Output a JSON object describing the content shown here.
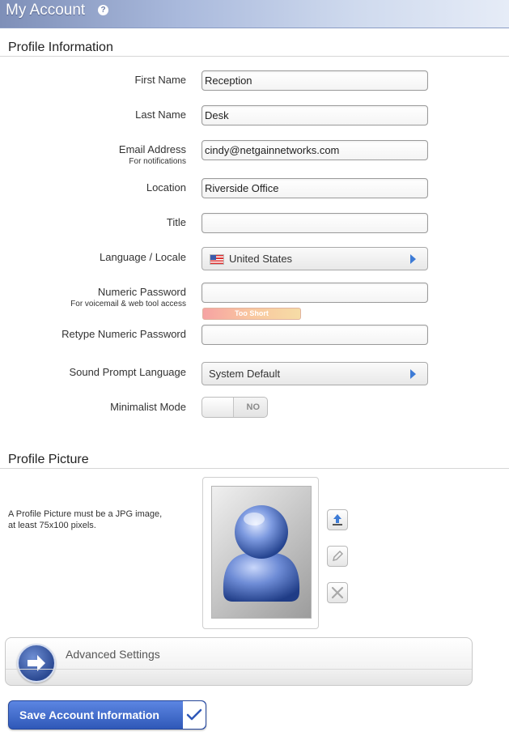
{
  "header": {
    "title": "My Account",
    "help_glyph": "?"
  },
  "profile": {
    "section_title": "Profile Information",
    "first_name": {
      "label": "First Name",
      "value": "Reception"
    },
    "last_name": {
      "label": "Last Name",
      "value": "Desk"
    },
    "email": {
      "label": "Email Address",
      "sublabel": "For notifications",
      "value": "cindy@netgainnetworks.com"
    },
    "location": {
      "label": "Location",
      "value": "Riverside Office"
    },
    "title_field": {
      "label": "Title",
      "value": ""
    },
    "locale": {
      "label": "Language / Locale",
      "value": "United States",
      "icon": "us-flag-icon"
    },
    "numeric_password": {
      "label": "Numeric Password",
      "sublabel": "For voicemail & web tool access",
      "value": "",
      "strength": "Too Short"
    },
    "retype_password": {
      "label": "Retype Numeric Password",
      "value": ""
    },
    "sound_prompt": {
      "label": "Sound Prompt Language",
      "value": "System Default"
    },
    "minimalist": {
      "label": "Minimalist Mode",
      "state": "NO"
    }
  },
  "picture": {
    "section_title": "Profile Picture",
    "note_line1": "A Profile Picture must be a JPG image,",
    "note_line2": "at least 75x100 pixels."
  },
  "advanced": {
    "label": "Advanced Settings"
  },
  "save": {
    "label": "Save Account Information"
  },
  "colors": {
    "accent": "#2f58b8",
    "arrow": "#3d7bd6"
  }
}
